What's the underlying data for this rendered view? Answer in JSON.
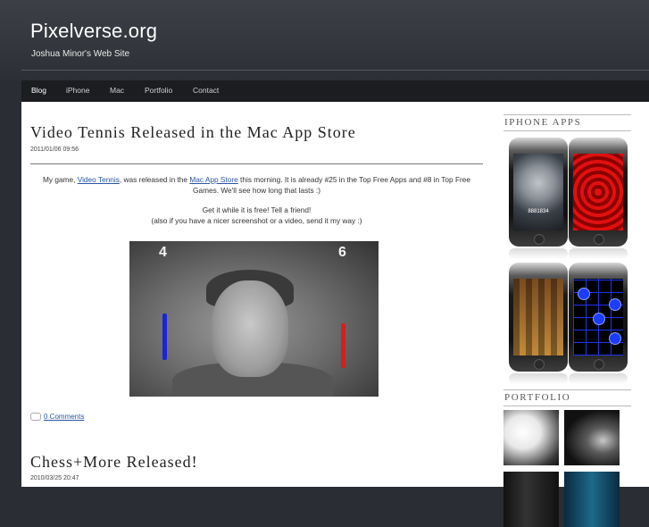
{
  "site": {
    "title": "Pixelverse.org",
    "subtitle": "Joshua Minor's Web Site"
  },
  "nav": {
    "items": [
      {
        "label": "Blog"
      },
      {
        "label": "iPhone"
      },
      {
        "label": "Mac"
      },
      {
        "label": "Portfolio"
      },
      {
        "label": "Contact"
      }
    ],
    "active": "Blog"
  },
  "posts": [
    {
      "title": "Video Tennis Released in the Mac App Store",
      "date": "2011/01/06 09:56",
      "body": {
        "line1_prefix": "My game, ",
        "line1_link1": "Video Tennis",
        "line1_middle": ", was released in the ",
        "line1_link2": "Mac App Store",
        "line1_suffix": " this morning. It is already #25 in the Top Free Apps and #8 in Top Free Games. We'll see how long that lasts :)",
        "line2": "Get it while it is free! Tell a friend!",
        "line3": "(also if you have a nicer screenshot or a video, send it my way :)"
      },
      "screenshot": {
        "score_left": "4",
        "score_right": "6"
      },
      "comments": "0 Comments"
    },
    {
      "title": "Chess+More Released!",
      "date": "2010/03/25 20:47"
    }
  ],
  "sidebar": {
    "iphone_heading": "IPHONE APPS",
    "dial_number": "8881834",
    "portfolio_heading": "PORTFOLIO"
  },
  "colors": {
    "link": "#2a55a8",
    "header_bg": "#34373d",
    "nav_bg": "#1b1d21",
    "paddle_left": "#1d23d8",
    "paddle_right": "#d81d1d"
  }
}
